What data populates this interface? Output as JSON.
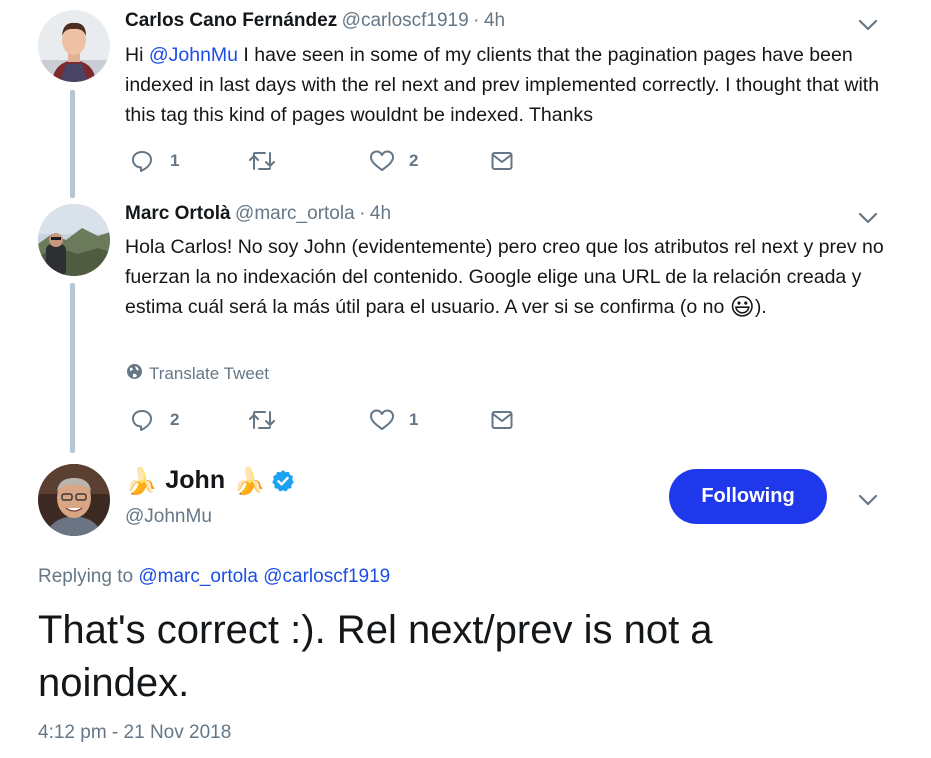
{
  "tweets": [
    {
      "name": "Carlos Cano Fernández",
      "handle": "@carloscf1919",
      "separator": "·",
      "time": "4h",
      "text_before": "Hi ",
      "mention": "@JohnMu",
      "text_after": " I have seen in some of my clients that the pagination pages have been indexed in last days with the rel next and prev implemented correctly. I thought that with this tag this kind of pages wouldnt be indexed. Thanks",
      "replies": "1",
      "retweets": "",
      "likes": "2"
    },
    {
      "name": "Marc Ortolà",
      "handle": "@marc_ortola",
      "separator": "·",
      "time": "4h",
      "text": "Hola Carlos! No soy John (evidentemente) pero creo que los atributos rel next y prev no fuerzan la no indexación del contenido. Google elige una URL de la relación creada y estima cuál será la más útil para el usuario. A ver si se confirma (o no ",
      "emoji": "😃",
      "text_end": ").",
      "translate_label": "Translate Tweet",
      "replies": "2",
      "retweets": "",
      "likes": "1"
    }
  ],
  "main_tweet": {
    "banana": "🍌",
    "name": "John",
    "handle": "@JohnMu",
    "follow_label": "Following",
    "replying_prefix": "Replying to",
    "replying_to": [
      "@marc_ortola",
      "@carloscf1919"
    ],
    "text": "That's correct :). Rel next/prev is not a noindex.",
    "timestamp": "4:12 pm - 21 Nov 2018"
  },
  "colors": {
    "accent": "#2038ec",
    "mention": "#1b4ee6",
    "muted": "#657786",
    "verified": "#1da1f2",
    "thread_line": "#b7c6d4"
  },
  "icons": [
    "reply-icon",
    "retweet-icon",
    "like-icon",
    "message-icon",
    "chevron-down-icon",
    "globe-icon",
    "verified-badge-icon"
  ]
}
